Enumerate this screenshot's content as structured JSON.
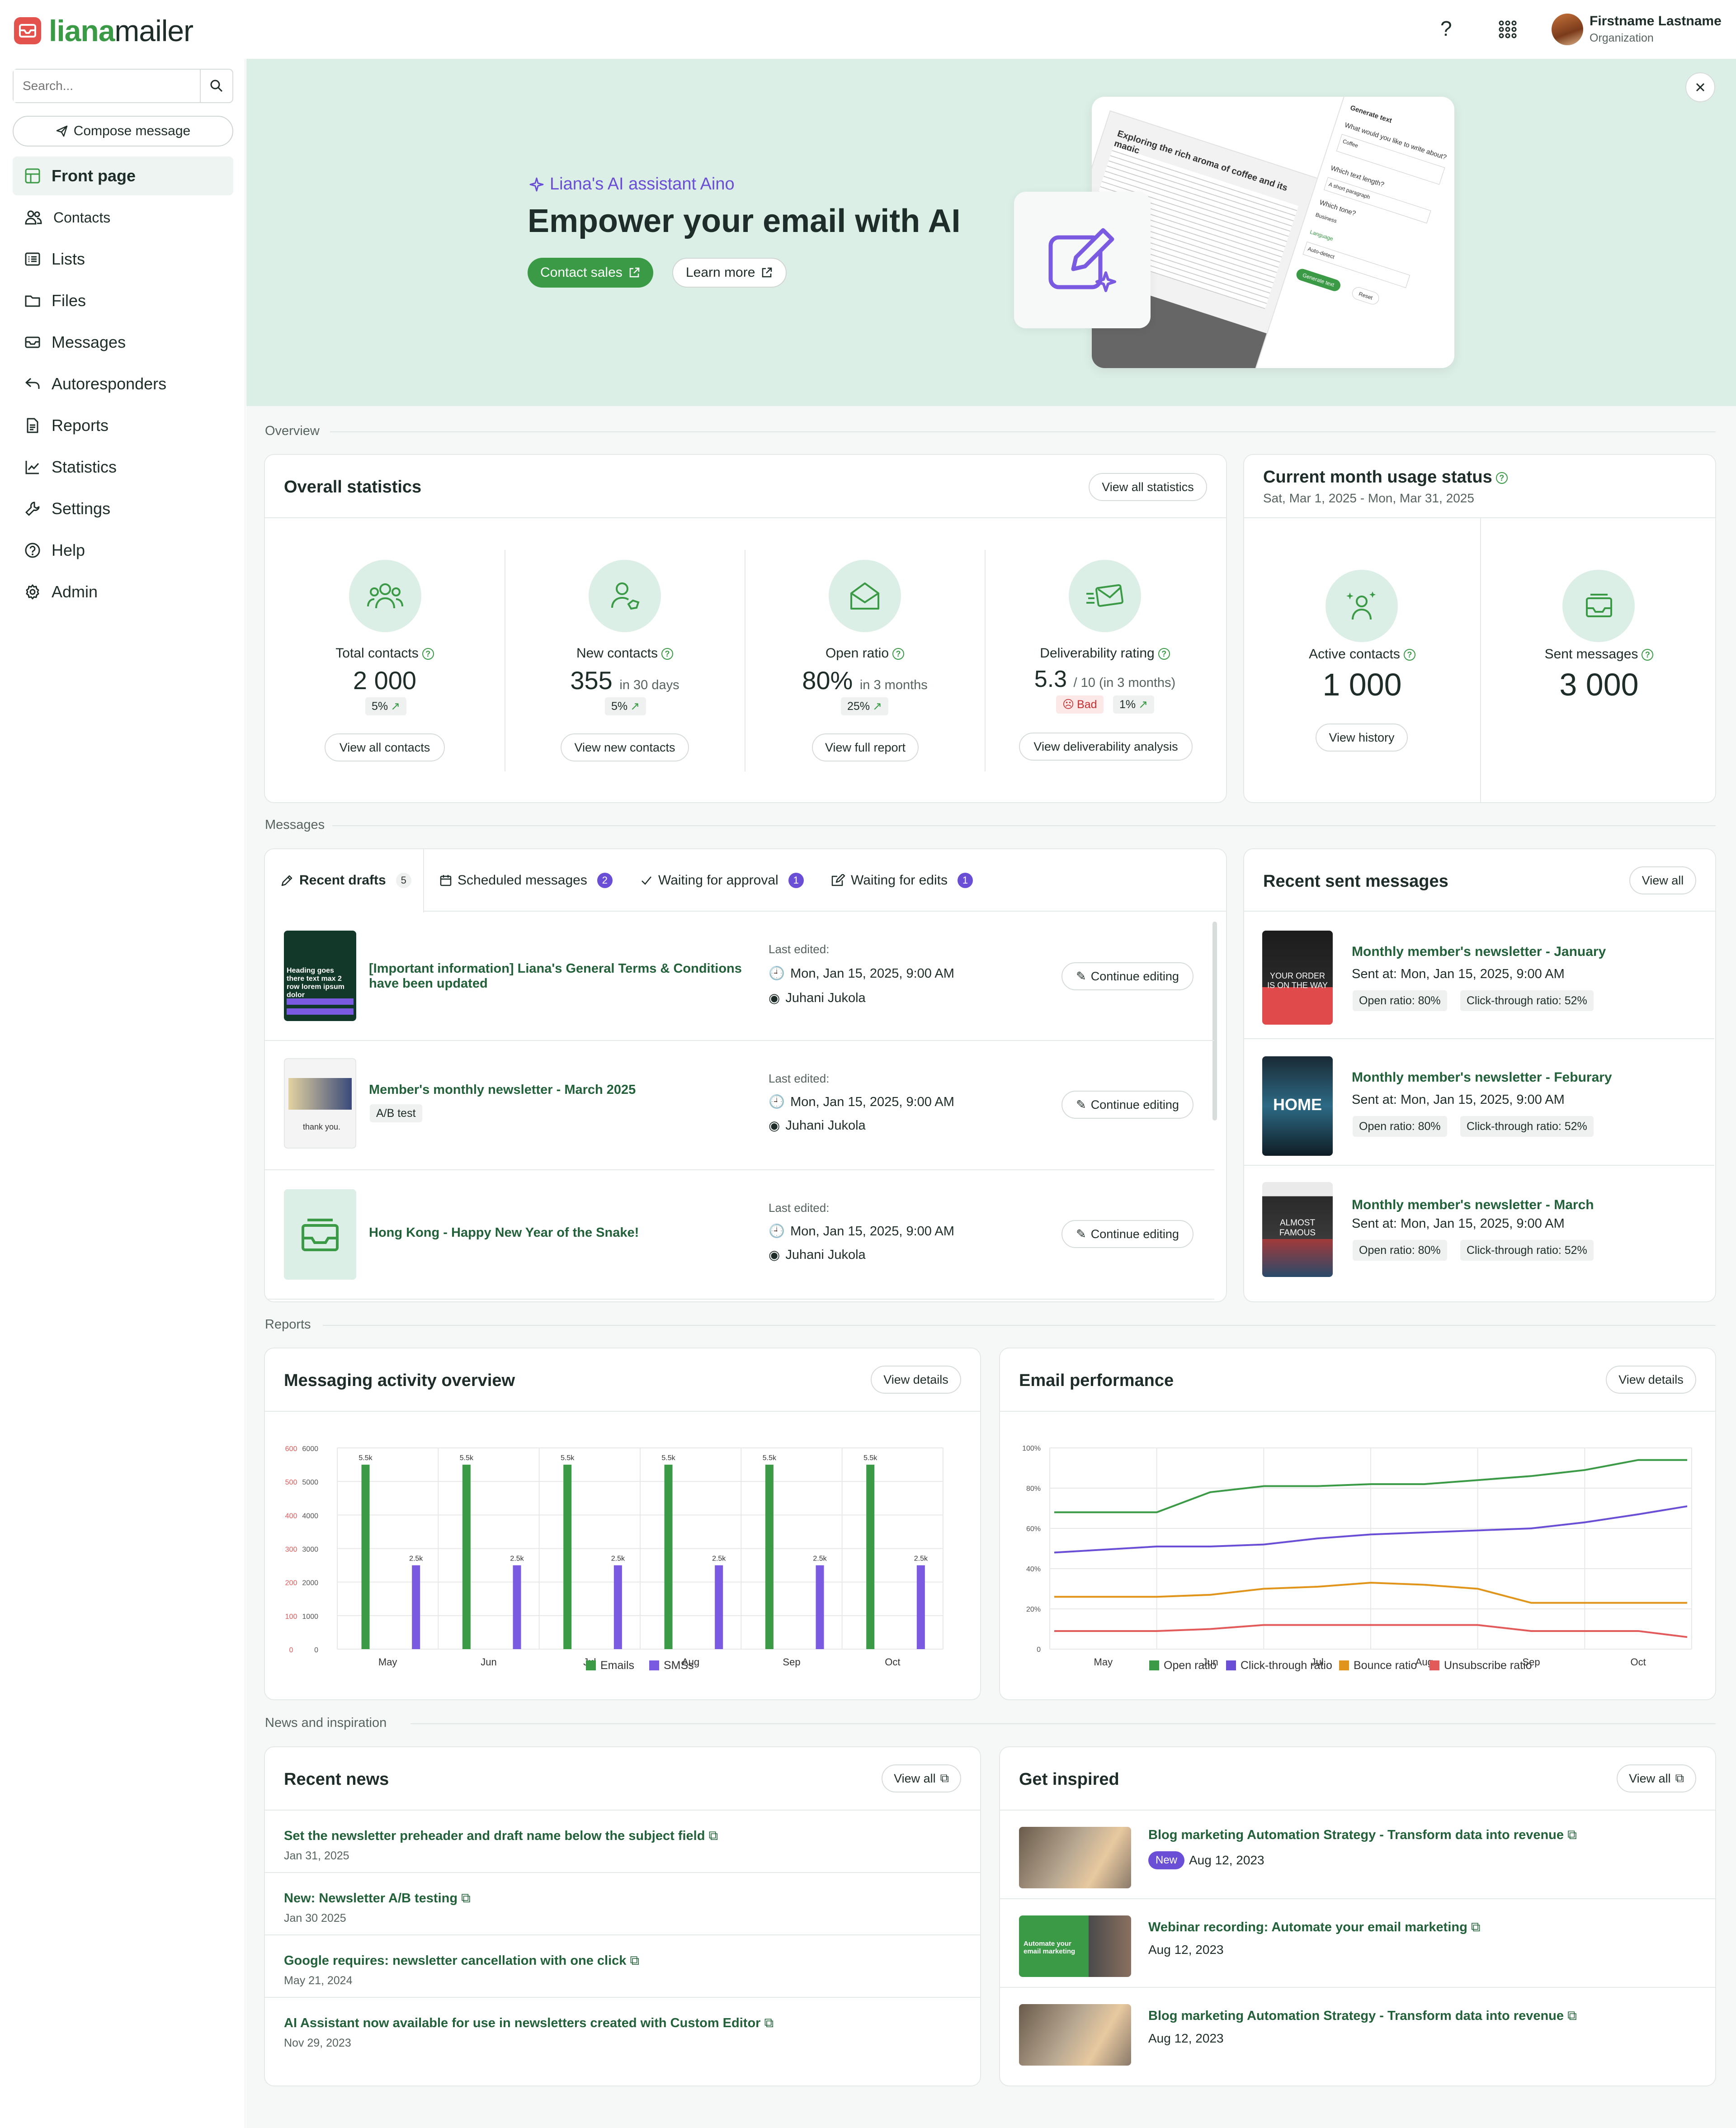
{
  "app": {
    "name_part1": "liana",
    "name_part2": "mailer"
  },
  "header": {
    "help_icon": "?",
    "user_name": "Firstname Lastname",
    "user_org": "Organization"
  },
  "sidebar": {
    "search_placeholder": "Search...",
    "compose_label": "Compose message",
    "items": [
      {
        "label": "Front page",
        "icon": "grid-icon"
      },
      {
        "label": "Contacts",
        "icon": "people-icon"
      },
      {
        "label": "Lists",
        "icon": "list-icon"
      },
      {
        "label": "Files",
        "icon": "folder-icon"
      },
      {
        "label": "Messages",
        "icon": "envelope-icon"
      },
      {
        "label": "Autoresponders",
        "icon": "reply-icon"
      },
      {
        "label": "Reports",
        "icon": "document-icon"
      },
      {
        "label": "Statistics",
        "icon": "chart-icon"
      },
      {
        "label": "Settings",
        "icon": "wrench-icon"
      },
      {
        "label": "Help",
        "icon": "help-circle-icon"
      },
      {
        "label": "Admin",
        "icon": "gear-icon"
      }
    ]
  },
  "hero": {
    "eyebrow": "Liana's AI assistant Aino",
    "title": "Empower your email with AI",
    "contact_sales": "Contact sales",
    "learn_more": "Learn more",
    "mock_article_title": "Exploring the rich aroma of coffee and its magic",
    "mock_panel_title": "Generate text",
    "mock_q1": "What would you like to write about?",
    "mock_a1": "Coffee",
    "mock_q2": "Which text length?",
    "mock_a2": "A short paragraph",
    "mock_q3": "Which tone?",
    "mock_a3": "Business",
    "mock_q4": "Language",
    "mock_a4": "Auto-detect",
    "mock_generate": "Generate text",
    "mock_reset": "Reset"
  },
  "sections": {
    "overview": "Overview",
    "messages": "Messages",
    "reports": "Reports",
    "news": "News and inspiration"
  },
  "overall": {
    "title": "Overall statistics",
    "view_all": "View all statistics",
    "stats": [
      {
        "label": "Total contacts",
        "value": "2 000",
        "suffix": "",
        "chip": "5%",
        "button": "View all contacts"
      },
      {
        "label": "New contacts",
        "value": "355",
        "suffix": "in 30 days",
        "chip": "5%",
        "button": "View new contacts"
      },
      {
        "label": "Open ratio",
        "value": "80%",
        "suffix": "in 3 months",
        "chip": "25%",
        "button": "View full report"
      },
      {
        "label": "Deliverability rating",
        "value": "5.3",
        "suffix": "/ 10 (in 3 months)",
        "chip": "1%",
        "bad": "Bad",
        "button": "View deliverability analysis"
      }
    ]
  },
  "usage": {
    "title": "Current month usage status",
    "period": "Sat, Mar 1, 2025 - Mon, Mar 31, 2025",
    "active_label": "Active contacts",
    "active_value": "1 000",
    "history_button": "View history",
    "sent_label": "Sent messages",
    "sent_value": "3 000"
  },
  "drafts": {
    "tabs": [
      {
        "label": "Recent drafts",
        "count": "5"
      },
      {
        "label": "Scheduled messages",
        "count": "2"
      },
      {
        "label": "Waiting for approval",
        "count": "1"
      },
      {
        "label": "Waiting for edits",
        "count": "1"
      }
    ],
    "rows": [
      {
        "title": "[Important information] Liana's General Terms & Conditions have been updated",
        "tag": "",
        "last_edited": "Last edited:",
        "date": "Mon, Jan 15, 2025, 9:00 AM",
        "user": "Juhani Jukola",
        "button": "Continue editing",
        "thumb_text": "Heading goes there text max 2 row lorem ipsum dolor"
      },
      {
        "title": "Member's monthly newsletter - March 2025",
        "tag": "A/B test",
        "last_edited": "Last edited:",
        "date": "Mon, Jan 15, 2025, 9:00 AM",
        "user": "Juhani Jukola",
        "button": "Continue editing",
        "thumb_text": "thank you."
      },
      {
        "title": "Hong Kong - Happy New Year of the Snake!",
        "tag": "",
        "last_edited": "Last edited:",
        "date": "Mon, Jan 15, 2025, 9:00 AM",
        "user": "Juhani Jukola",
        "button": "Continue editing",
        "thumb_text": ""
      }
    ]
  },
  "recent_sent": {
    "title": "Recent sent messages",
    "view_all": "View all",
    "rows": [
      {
        "title": "Monthly member's newsletter - January",
        "sent": "Sent at: Mon, Jan 15, 2025, 9:00 AM",
        "open": "Open ratio: 80%",
        "click": "Click-through ratio: 52%",
        "thumb_text": "YOUR ORDER IS ON THE WAY"
      },
      {
        "title": "Monthly member's newsletter - Feburary",
        "sent": "Sent at: Mon, Jan 15, 2025, 9:00 AM",
        "open": "Open ratio: 80%",
        "click": "Click-through ratio: 52%",
        "thumb_text": "HOME"
      },
      {
        "title": "Monthly member's newsletter - March",
        "sent": "Sent at: Mon, Jan 15, 2025, 9:00 AM",
        "open": "Open ratio: 80%",
        "click": "Click-through ratio: 52%",
        "thumb_text": "ALMOST FAMOUS"
      }
    ]
  },
  "reports": {
    "activity_title": "Messaging activity overview",
    "activity_button": "View details",
    "performance_title": "Email performance",
    "performance_button": "View details"
  },
  "chart_data": [
    {
      "type": "bar",
      "categories": [
        "May",
        "Jun",
        "Jul",
        "Aug",
        "Sep",
        "Oct"
      ],
      "series": [
        {
          "name": "Emails",
          "values": [
            5500,
            5500,
            5500,
            5500,
            5500,
            5500
          ],
          "labels": [
            "5.5k",
            "5.5k",
            "5.5k",
            "5.5k",
            "5.5k",
            "5.5k"
          ],
          "color": "#3a9a45",
          "axis": "right"
        },
        {
          "name": "SMSs",
          "values": [
            2500,
            2500,
            2500,
            2500,
            2500,
            2500
          ],
          "labels": [
            "2.5k",
            "2.5k",
            "2.5k",
            "2.5k",
            "2.5k",
            "2.5k"
          ],
          "color": "#7a5ae0",
          "axis": "right"
        }
      ],
      "y_left_ticks": [
        "0",
        "100",
        "200",
        "300",
        "400",
        "500",
        "600"
      ],
      "y_right_ticks": [
        "0",
        "1000",
        "2000",
        "3000",
        "4000",
        "5000",
        "6000"
      ],
      "ylim": [
        0,
        6000
      ]
    },
    {
      "type": "line",
      "categories": [
        "May",
        "Jun",
        "Jul",
        "Aug",
        "Sep",
        "Oct"
      ],
      "y_ticks": [
        "0",
        "20%",
        "40%",
        "60%",
        "80%",
        "100%"
      ],
      "ylim": [
        0,
        100
      ],
      "x": [
        0,
        0.5,
        1,
        1.5,
        2,
        2.5,
        3,
        3.5,
        4,
        4.5,
        5,
        5.5
      ],
      "series": [
        {
          "name": "Open ratio",
          "color": "#3a9a45",
          "values": [
            68,
            68,
            78,
            81,
            81,
            82,
            82,
            84,
            86,
            89,
            94,
            94
          ]
        },
        {
          "name": "Click-through ratio",
          "color": "#6a4fd6",
          "values": [
            48,
            51,
            51,
            52,
            55,
            57,
            58,
            59,
            60,
            63,
            67,
            71
          ]
        },
        {
          "name": "Bounce ratio",
          "color": "#e0941a",
          "values": [
            26,
            26,
            27,
            30,
            31,
            33,
            32,
            30,
            23,
            23,
            23,
            23
          ]
        },
        {
          "name": "Unsubscribe ratio",
          "color": "#e25a5a",
          "values": [
            9,
            9,
            10,
            12,
            12,
            12,
            12,
            12,
            9,
            9,
            9,
            6
          ]
        }
      ]
    }
  ],
  "news": {
    "title": "Recent news",
    "view_all": "View all",
    "items": [
      {
        "title": "Set the newsletter preheader and draft name below the subject field",
        "date": "Jan 31, 2025"
      },
      {
        "title": "New: Newsletter A/B testing",
        "date": "Jan 30 2025"
      },
      {
        "title": "Google requires: newsletter cancellation with one click",
        "date": "May 21, 2024"
      },
      {
        "title": "AI Assistant now available for use in newsletters created with Custom Editor",
        "date": "Nov 29, 2023"
      }
    ]
  },
  "inspired": {
    "title": "Get inspired",
    "view_all": "View all",
    "items": [
      {
        "title": "Blog marketing Automation Strategy - Transform data into revenue",
        "date": "Aug 12, 2023",
        "badge": "New"
      },
      {
        "title": "Webinar recording: Automate your email marketing",
        "date": "Aug 12, 2023",
        "badge": "",
        "thumb_text": "Automate your email marketing"
      },
      {
        "title": "Blog marketing Automation Strategy - Transform data into revenue",
        "date": "Aug 12, 2023",
        "badge": ""
      }
    ]
  },
  "colors": {
    "brand_green": "#3a9a45",
    "accent_purple": "#6a4fd6",
    "hero_bg": "#dcefe6",
    "logo_red": "#e4524e"
  }
}
